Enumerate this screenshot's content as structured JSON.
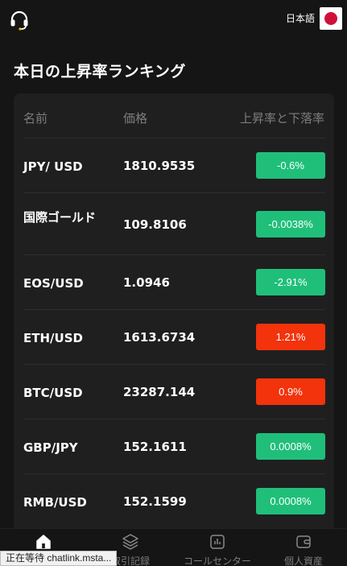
{
  "header": {
    "language_label": "日本語"
  },
  "page_title": "本日の上昇率ランキング",
  "table": {
    "columns": [
      "名前",
      "価格",
      "上昇率と下落率"
    ],
    "rows": [
      {
        "name": "JPY/ USD",
        "price": "1810.9535",
        "change": "-0.6%",
        "trend": "green"
      },
      {
        "name": "国際ゴールド",
        "price": "109.8106",
        "change": "-0.0038%",
        "trend": "green"
      },
      {
        "name": "EOS/USD",
        "price": "1.0946",
        "change": "-2.91%",
        "trend": "green"
      },
      {
        "name": "ETH/USD",
        "price": "1613.6734",
        "change": "1.21%",
        "trend": "red"
      },
      {
        "name": "BTC/USD",
        "price": "23287.144",
        "change": "0.9%",
        "trend": "red"
      },
      {
        "name": "GBP/JPY",
        "price": "152.1611",
        "change": "0.0008%",
        "trend": "green"
      },
      {
        "name": "RMB/USD",
        "price": "152.1599",
        "change": "0.0008%",
        "trend": "green"
      }
    ]
  },
  "colors": {
    "green": "#1fbf7a",
    "red": "#f2330c",
    "background": "#151515",
    "card": "#1f1f1f"
  },
  "tabbar": {
    "items": [
      {
        "label": "",
        "icon": "home-icon",
        "active": true
      },
      {
        "label": "取引記録",
        "icon": "layers-icon",
        "active": false
      },
      {
        "label": "コールセンター",
        "icon": "chart-icon",
        "active": false
      },
      {
        "label": "個人資産",
        "icon": "wallet-icon",
        "active": false
      }
    ]
  },
  "status_popup": "正在等待 chatlink.msta..."
}
